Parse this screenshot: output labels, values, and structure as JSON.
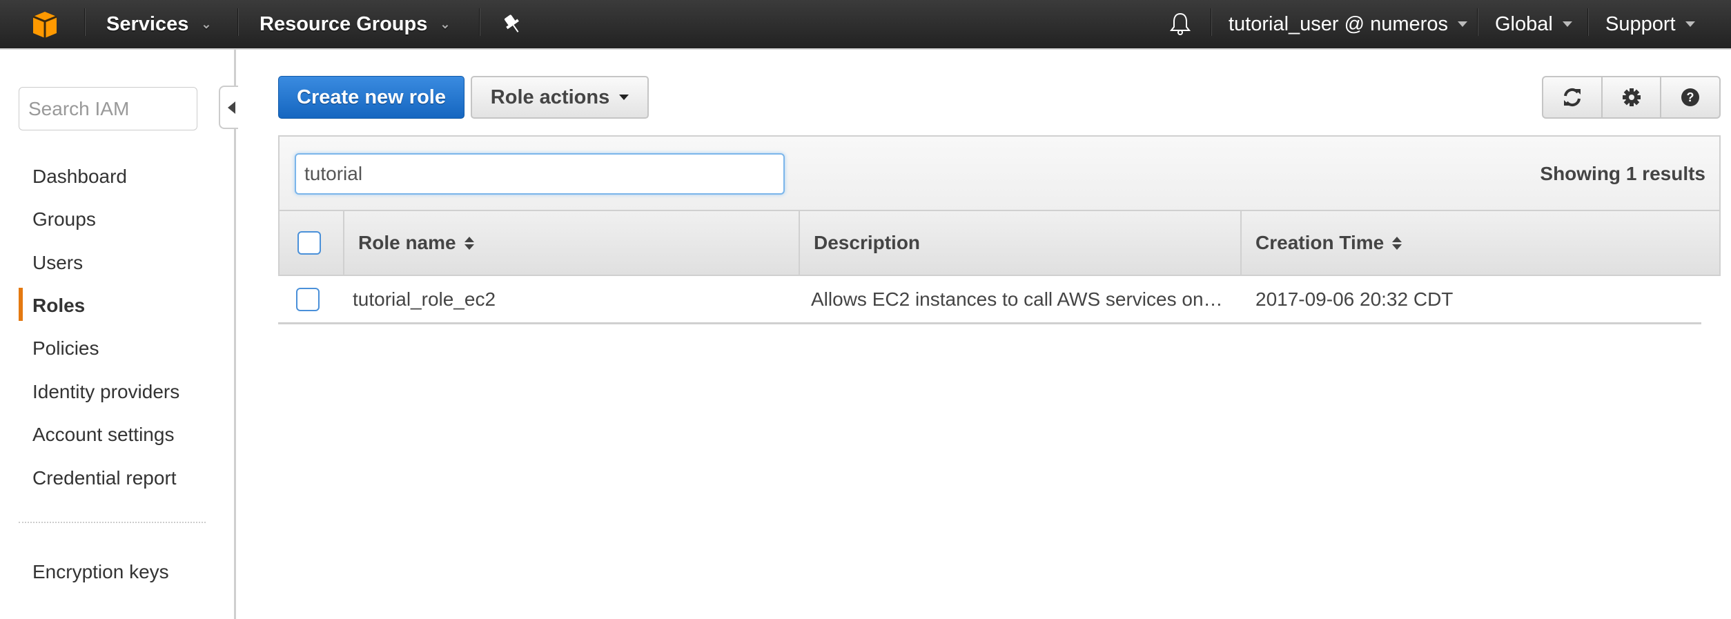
{
  "topnav": {
    "logo_icon": "aws-cube-icon",
    "services_label": "Services",
    "resource_groups_label": "Resource Groups",
    "pin_icon": "pushpin-icon",
    "bell_icon": "bell-icon",
    "account_label": "tutorial_user @ numeros",
    "region_label": "Global",
    "support_label": "Support"
  },
  "sidebar": {
    "search_placeholder": "Search IAM",
    "items": [
      {
        "label": "Dashboard",
        "active": false
      },
      {
        "label": "Groups",
        "active": false
      },
      {
        "label": "Users",
        "active": false
      },
      {
        "label": "Roles",
        "active": true
      },
      {
        "label": "Policies",
        "active": false
      },
      {
        "label": "Identity providers",
        "active": false
      },
      {
        "label": "Account settings",
        "active": false
      },
      {
        "label": "Credential report",
        "active": false
      }
    ],
    "secondary_items": [
      {
        "label": "Encryption keys"
      }
    ],
    "collapse_icon": "caret-left-icon",
    "active_color": "#e47911"
  },
  "toolbar": {
    "create_label": "Create new role",
    "actions_label": "Role actions",
    "refresh_icon": "refresh-icon",
    "settings_icon": "gear-icon",
    "help_icon": "help-icon"
  },
  "filter": {
    "value": "tutorial",
    "result_text": "Showing 1 results"
  },
  "table": {
    "columns": [
      "Role name",
      "Description",
      "Creation Time"
    ],
    "rows": [
      {
        "role_name": "tutorial_role_ec2",
        "description": "Allows EC2 instances to call AWS services on…",
        "creation_time": "2017-09-06 20:32 CDT",
        "selected": false
      }
    ]
  },
  "colors": {
    "primary_button": "#1566c0",
    "checkbox_border": "#4a90d9",
    "nav_bg": "#2b2b2b",
    "logo": "#ff9900"
  }
}
